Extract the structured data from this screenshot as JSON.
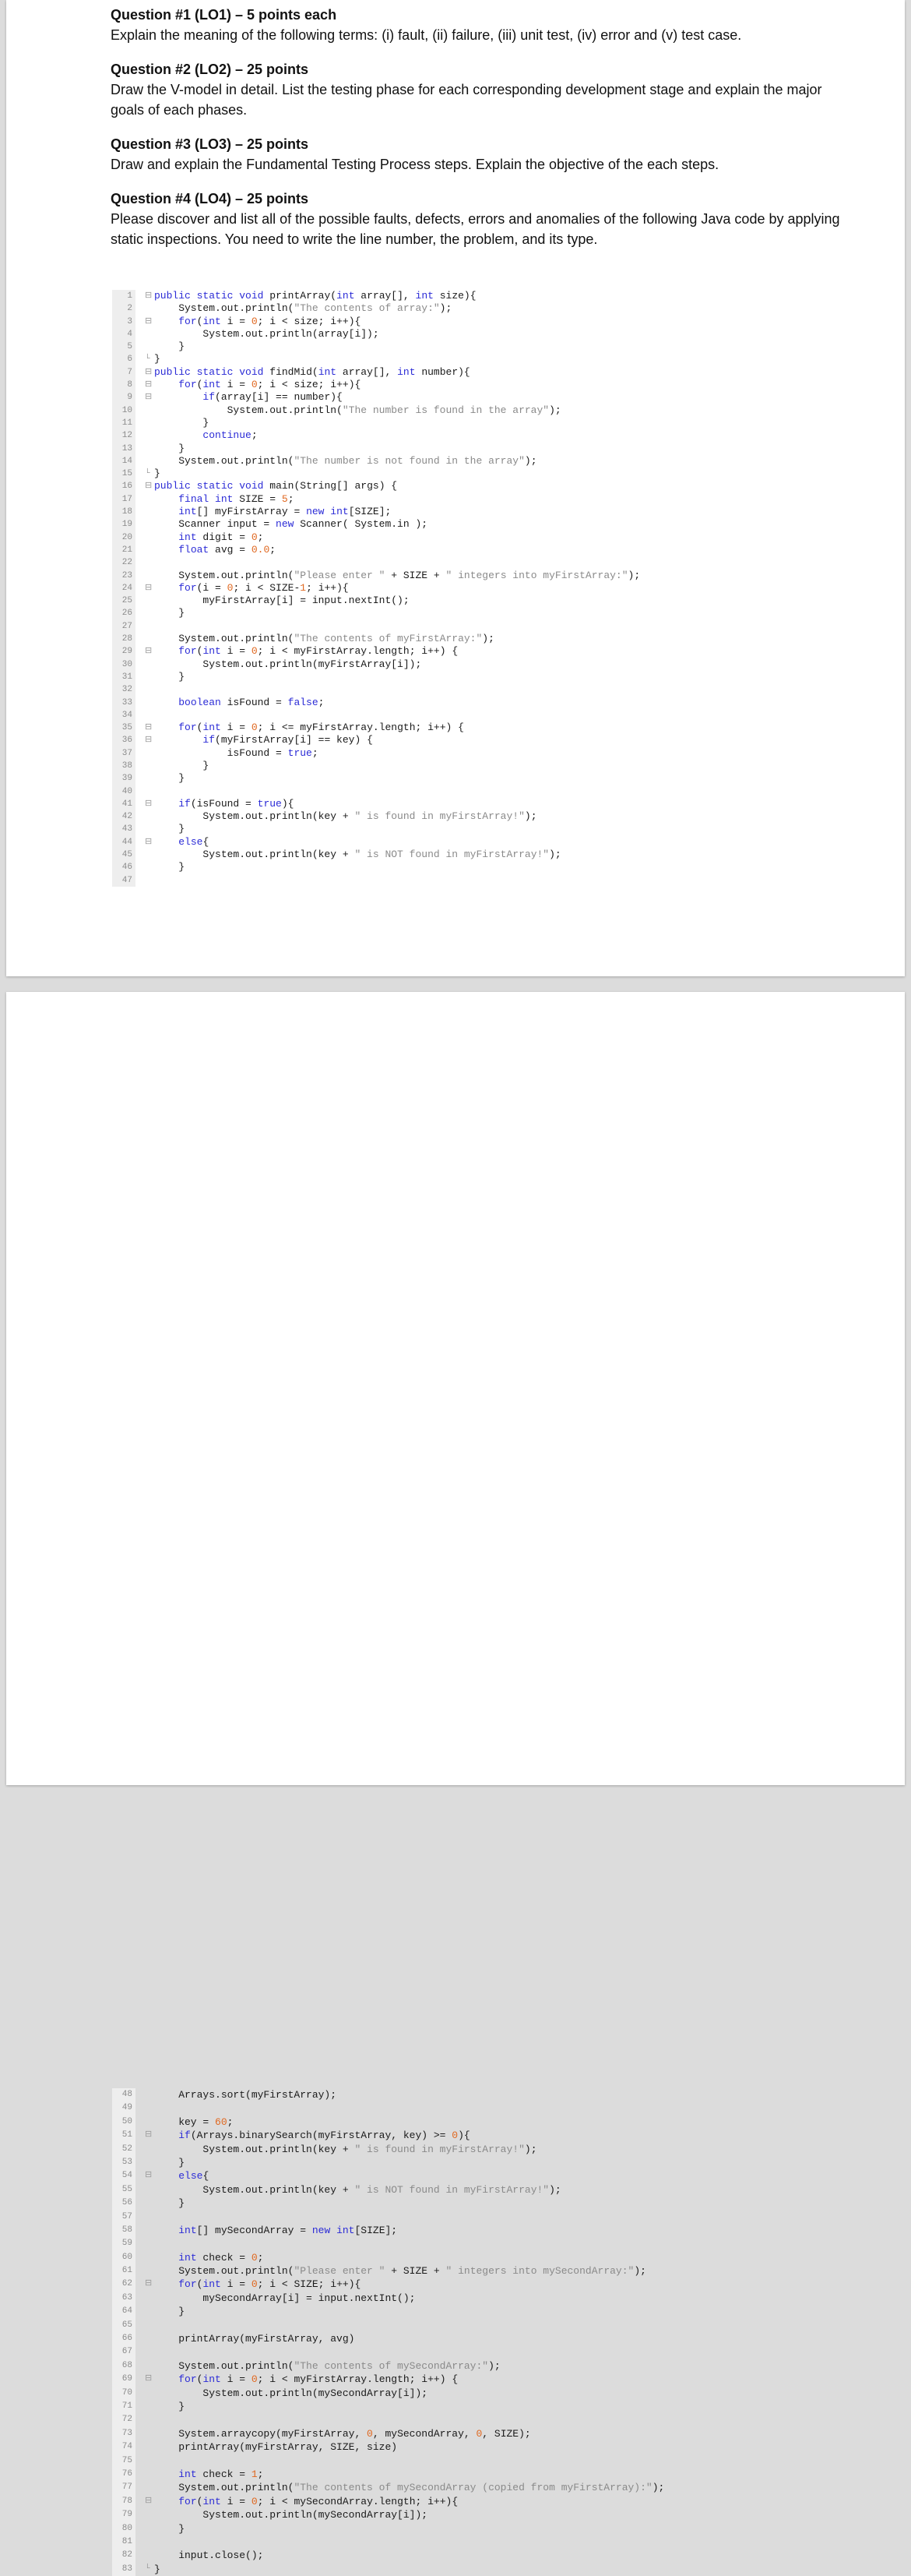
{
  "questions": [
    {
      "title": "Question #1 (LO1) – 5 points each",
      "body": "Explain the meaning of the following terms: (i) fault, (ii) failure, (iii) unit test, (iv) error and (v) test case."
    },
    {
      "title": "Question #2 (LO2) – 25 points",
      "body": "Draw the V-model in detail. List the testing phase for each corresponding development stage and explain the major goals of each phases."
    },
    {
      "title": "Question #3 (LO3) – 25 points",
      "body": "Draw and explain the Fundamental Testing Process steps. Explain the objective of the each steps."
    },
    {
      "title": "Question #4 (LO4) – 25 points",
      "body": "Please discover and list all of the possible faults, defects, errors and anomalies of the following Java code by applying static inspections. You need to write the line number, the problem, and its type."
    }
  ],
  "code_page1": [
    {
      "n": "1",
      "f": "⊟",
      "t": "public static void printArray(int array[], int size){"
    },
    {
      "n": "2",
      "f": "",
      "t": "    System.out.println(\"The contents of array:\");"
    },
    {
      "n": "3",
      "f": "⊟",
      "t": "    for(int i = 0; i < size; i++){"
    },
    {
      "n": "4",
      "f": "",
      "t": "        System.out.println(array[i]);"
    },
    {
      "n": "5",
      "f": "",
      "t": "    }"
    },
    {
      "n": "6",
      "f": "└",
      "t": "}"
    },
    {
      "n": "7",
      "f": "⊟",
      "t": "public static void findMid(int array[], int number){"
    },
    {
      "n": "8",
      "f": "⊟",
      "t": "    for(int i = 0; i < size; i++){"
    },
    {
      "n": "9",
      "f": "⊟",
      "t": "        if(array[i] == number){"
    },
    {
      "n": "10",
      "f": "",
      "t": "            System.out.println(\"The number is found in the array\");"
    },
    {
      "n": "11",
      "f": "",
      "t": "        }"
    },
    {
      "n": "12",
      "f": "",
      "t": "        continue;"
    },
    {
      "n": "13",
      "f": "",
      "t": "    }"
    },
    {
      "n": "14",
      "f": "",
      "t": "    System.out.println(\"The number is not found in the array\");"
    },
    {
      "n": "15",
      "f": "└",
      "t": "}"
    },
    {
      "n": "16",
      "f": "⊟",
      "t": "public static void main(String[] args) {"
    },
    {
      "n": "17",
      "f": "",
      "t": "    final int SIZE = 5;"
    },
    {
      "n": "18",
      "f": "",
      "t": "    int[] myFirstArray = new int[SIZE];"
    },
    {
      "n": "19",
      "f": "",
      "t": "    Scanner input = new Scanner( System.in );"
    },
    {
      "n": "20",
      "f": "",
      "t": "    int digit = 0;"
    },
    {
      "n": "21",
      "f": "",
      "t": "    float avg = 0.0;"
    },
    {
      "n": "22",
      "f": "",
      "t": ""
    },
    {
      "n": "23",
      "f": "",
      "t": "    System.out.println(\"Please enter \" + SIZE + \" integers into myFirstArray:\");"
    },
    {
      "n": "24",
      "f": "⊟",
      "t": "    for(i = 0; i < SIZE-1; i++){"
    },
    {
      "n": "25",
      "f": "",
      "t": "        myFirstArray[i] = input.nextInt();"
    },
    {
      "n": "26",
      "f": "",
      "t": "    }"
    },
    {
      "n": "27",
      "f": "",
      "t": ""
    },
    {
      "n": "28",
      "f": "",
      "t": "    System.out.println(\"The contents of myFirstArray:\");"
    },
    {
      "n": "29",
      "f": "⊟",
      "t": "    for(int i = 0; i < myFirstArray.length; i++) {"
    },
    {
      "n": "30",
      "f": "",
      "t": "        System.out.println(myFirstArray[i]);"
    },
    {
      "n": "31",
      "f": "",
      "t": "    }"
    },
    {
      "n": "32",
      "f": "",
      "t": ""
    },
    {
      "n": "33",
      "f": "",
      "t": "    boolean isFound = false;"
    },
    {
      "n": "34",
      "f": "",
      "t": ""
    },
    {
      "n": "35",
      "f": "⊟",
      "t": "    for(int i = 0; i <= myFirstArray.length; i++) {"
    },
    {
      "n": "36",
      "f": "⊟",
      "t": "        if(myFirstArray[i] == key) {"
    },
    {
      "n": "37",
      "f": "",
      "t": "            isFound = true;"
    },
    {
      "n": "38",
      "f": "",
      "t": "        }"
    },
    {
      "n": "39",
      "f": "",
      "t": "    }"
    },
    {
      "n": "40",
      "f": "",
      "t": ""
    },
    {
      "n": "41",
      "f": "⊟",
      "t": "    if(isFound = true){"
    },
    {
      "n": "42",
      "f": "",
      "t": "        System.out.println(key + \" is found in myFirstArray!\");"
    },
    {
      "n": "43",
      "f": "",
      "t": "    }"
    },
    {
      "n": "44",
      "f": "⊟",
      "t": "    else{"
    },
    {
      "n": "45",
      "f": "",
      "t": "        System.out.println(key + \" is NOT found in myFirstArray!\");"
    },
    {
      "n": "46",
      "f": "",
      "t": "    }"
    },
    {
      "n": "47",
      "f": "",
      "t": ""
    }
  ],
  "code_page2": [
    {
      "n": "48",
      "f": "",
      "t": "    Arrays.sort(myFirstArray);"
    },
    {
      "n": "49",
      "f": "",
      "t": ""
    },
    {
      "n": "50",
      "f": "",
      "t": "    key = 60;"
    },
    {
      "n": "51",
      "f": "⊟",
      "t": "    if(Arrays.binarySearch(myFirstArray, key) >= 0){"
    },
    {
      "n": "52",
      "f": "",
      "t": "        System.out.println(key + \" is found in myFirstArray!\");"
    },
    {
      "n": "53",
      "f": "",
      "t": "    }"
    },
    {
      "n": "54",
      "f": "⊟",
      "t": "    else{"
    },
    {
      "n": "55",
      "f": "",
      "t": "        System.out.println(key + \" is NOT found in myFirstArray!\");"
    },
    {
      "n": "56",
      "f": "",
      "t": "    }"
    },
    {
      "n": "57",
      "f": "",
      "t": ""
    },
    {
      "n": "58",
      "f": "",
      "t": "    int[] mySecondArray = new int[SIZE];"
    },
    {
      "n": "59",
      "f": "",
      "t": ""
    },
    {
      "n": "60",
      "f": "",
      "t": "    int check = 0;"
    },
    {
      "n": "61",
      "f": "",
      "t": "    System.out.println(\"Please enter \" + SIZE + \" integers into mySecondArray:\");"
    },
    {
      "n": "62",
      "f": "⊟",
      "t": "    for(int i = 0; i < SIZE; i++){"
    },
    {
      "n": "63",
      "f": "",
      "t": "        mySecondArray[i] = input.nextInt();"
    },
    {
      "n": "64",
      "f": "",
      "t": "    }"
    },
    {
      "n": "65",
      "f": "",
      "t": ""
    },
    {
      "n": "66",
      "f": "",
      "t": "    printArray(myFirstArray, avg)"
    },
    {
      "n": "67",
      "f": "",
      "t": ""
    },
    {
      "n": "68",
      "f": "",
      "t": "    System.out.println(\"The contents of mySecondArray:\");"
    },
    {
      "n": "69",
      "f": "⊟",
      "t": "    for(int i = 0; i < myFirstArray.length; i++) {"
    },
    {
      "n": "70",
      "f": "",
      "t": "        System.out.println(mySecondArray[i]);"
    },
    {
      "n": "71",
      "f": "",
      "t": "    }"
    },
    {
      "n": "72",
      "f": "",
      "t": ""
    },
    {
      "n": "73",
      "f": "",
      "t": "    System.arraycopy(myFirstArray, 0, mySecondArray, 0, SIZE);"
    },
    {
      "n": "74",
      "f": "",
      "t": "    printArray(myFirstArray, SIZE, size)"
    },
    {
      "n": "75",
      "f": "",
      "t": ""
    },
    {
      "n": "76",
      "f": "",
      "t": "    int check = 1;"
    },
    {
      "n": "77",
      "f": "",
      "t": "    System.out.println(\"The contents of mySecondArray (copied from myFirstArray):\");"
    },
    {
      "n": "78",
      "f": "⊟",
      "t": "    for(int i = 0; i < mySecondArray.length; i++){"
    },
    {
      "n": "79",
      "f": "",
      "t": "        System.out.println(mySecondArray[i]);"
    },
    {
      "n": "80",
      "f": "",
      "t": "    }"
    },
    {
      "n": "81",
      "f": "",
      "t": ""
    },
    {
      "n": "82",
      "f": "",
      "t": "    input.close();"
    },
    {
      "n": "83",
      "f": "└",
      "t": "}"
    }
  ]
}
